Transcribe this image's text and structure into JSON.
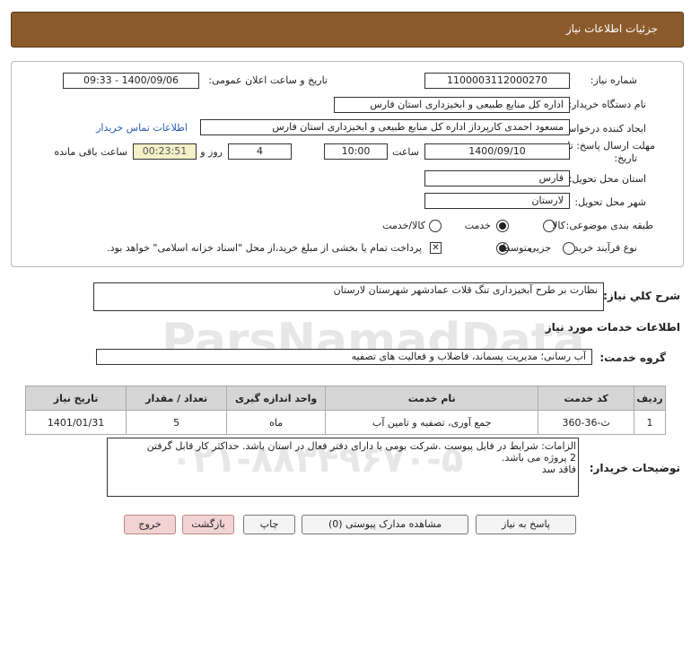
{
  "header": {
    "title": "جزئیات اطلاعات نیاز"
  },
  "fields": {
    "need_number_label": "شماره نیاز:",
    "need_number": "1100003112000270",
    "announce_label": "تاریخ و ساعت اعلان عمومی:",
    "announce_value": "1400/09/06 - 09:33",
    "buyer_label": "نام دستگاه خریدار:",
    "buyer_value": "اداره کل منابع طبیعی و ابخیزداری استان فارس",
    "creator_label": "ایجاد کننده درخواست:",
    "creator_value": "مسعود احمدی کارپرداز اداره کل منابع طبیعی و ابخیزداری استان فارس",
    "contact_link": "اطلاعات تماس خریدار",
    "deadline_label_1": "مهلت ارسال پاسخ: تا",
    "deadline_label_2": "تاریخ:",
    "deadline_date": "1400/09/10",
    "time_label": "ساعت",
    "deadline_time": "10:00",
    "days_value": "4",
    "days_label": "روز و",
    "remaining_time": "00:23:51",
    "remaining_label": "ساعت باقی مانده",
    "province_label": "استان محل تحویل:",
    "province_value": "فارس",
    "city_label": "شهر محل تحویل:",
    "city_value": "لارستان",
    "category_label": "طبقه بندی موضوعی:",
    "category_options": [
      "کالا",
      "خدمت",
      "کالا/خدمت"
    ],
    "process_label": "نوع فرآیند خرید :",
    "process_options": [
      "جزیی",
      "متوسط"
    ],
    "payment_note": "پرداخت تمام یا بخشی از مبلغ خرید،از محل \"اسناد خزانه اسلامی\" خواهد بود."
  },
  "summary": {
    "label": "شرح کلي نياز:",
    "value": "نظارت بر طرح آبخیزداری تنگ قلات عمادشهر شهرستان لارستان"
  },
  "services": {
    "title": "اطلاعات خدمات مورد نیاز",
    "group_label": "گروه خدمت:",
    "group_value": "آب رسانی؛ مدیریت پسماند، فاضلاب و فعالیت های تصفیه",
    "columns": [
      "ردیف",
      "کد خدمت",
      "نام خدمت",
      "واحد اندازه گیری",
      "تعداد / مقدار",
      "تاریخ نیاز"
    ],
    "rows": [
      [
        "1",
        "ث-36-360",
        "جمع آوری، تصفیه و تامین آب",
        "ماه",
        "5",
        "1401/01/31"
      ]
    ]
  },
  "buyer_notes": {
    "label": "توضیحات خریدار:",
    "lines": [
      "الزامات: شرایط در فایل پیوست .شرکت بومی یا دارای دفتر فعال در استان باشد. حداکثر کار قابل گرفتن",
      "2 پروژه می باشد.",
      "فاقد سد"
    ]
  },
  "buttons": {
    "reply": "پاسخ به نیاز",
    "attachments": "مشاهده مدارک پیوستی (0)",
    "print": "چاپ",
    "back": "بازگشت",
    "exit": "خروج"
  }
}
